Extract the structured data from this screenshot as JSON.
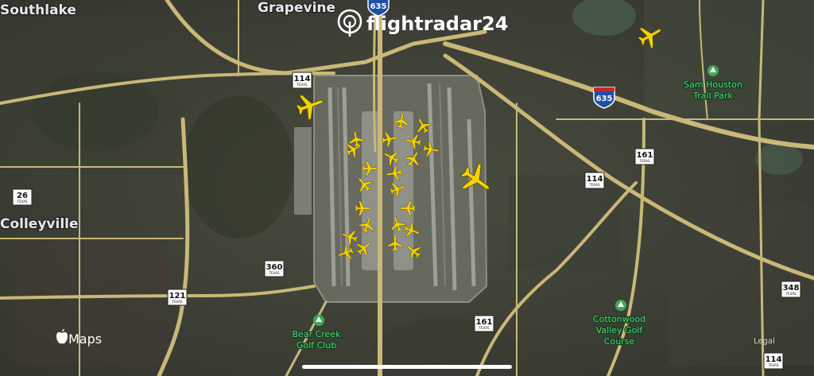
{
  "brand": {
    "name": "flightradar24"
  },
  "map_labels": {
    "southlake": "Southlake",
    "grapevine": "Grapevine",
    "colleyville": "Colleyville",
    "legal": "Legal"
  },
  "parks": [
    {
      "id": "sam-houston",
      "lines": [
        "Sam Houston",
        "Trail Park"
      ]
    },
    {
      "id": "bear-creek",
      "lines": [
        "Bear Creek",
        "Golf Club"
      ]
    },
    {
      "id": "cottonwood",
      "lines": [
        "Cottonwood",
        "Valley Golf",
        "Course"
      ]
    }
  ],
  "shields": {
    "r114_a": "114",
    "r114_b": "114",
    "r114_c": "114",
    "r161_a": "161",
    "r161_b": "161",
    "r26": "26",
    "r360": "360",
    "r121": "121",
    "r348": "348",
    "r635": "635",
    "r635_top": "635",
    "state_suffix": "TEXAS",
    "interstate_suffix": "INTERSTATE"
  },
  "attribution": {
    "maps": "Maps"
  },
  "colors": {
    "aircraft": "#f2d300",
    "road": "#c9b878",
    "park_green": "#3fa85b"
  }
}
